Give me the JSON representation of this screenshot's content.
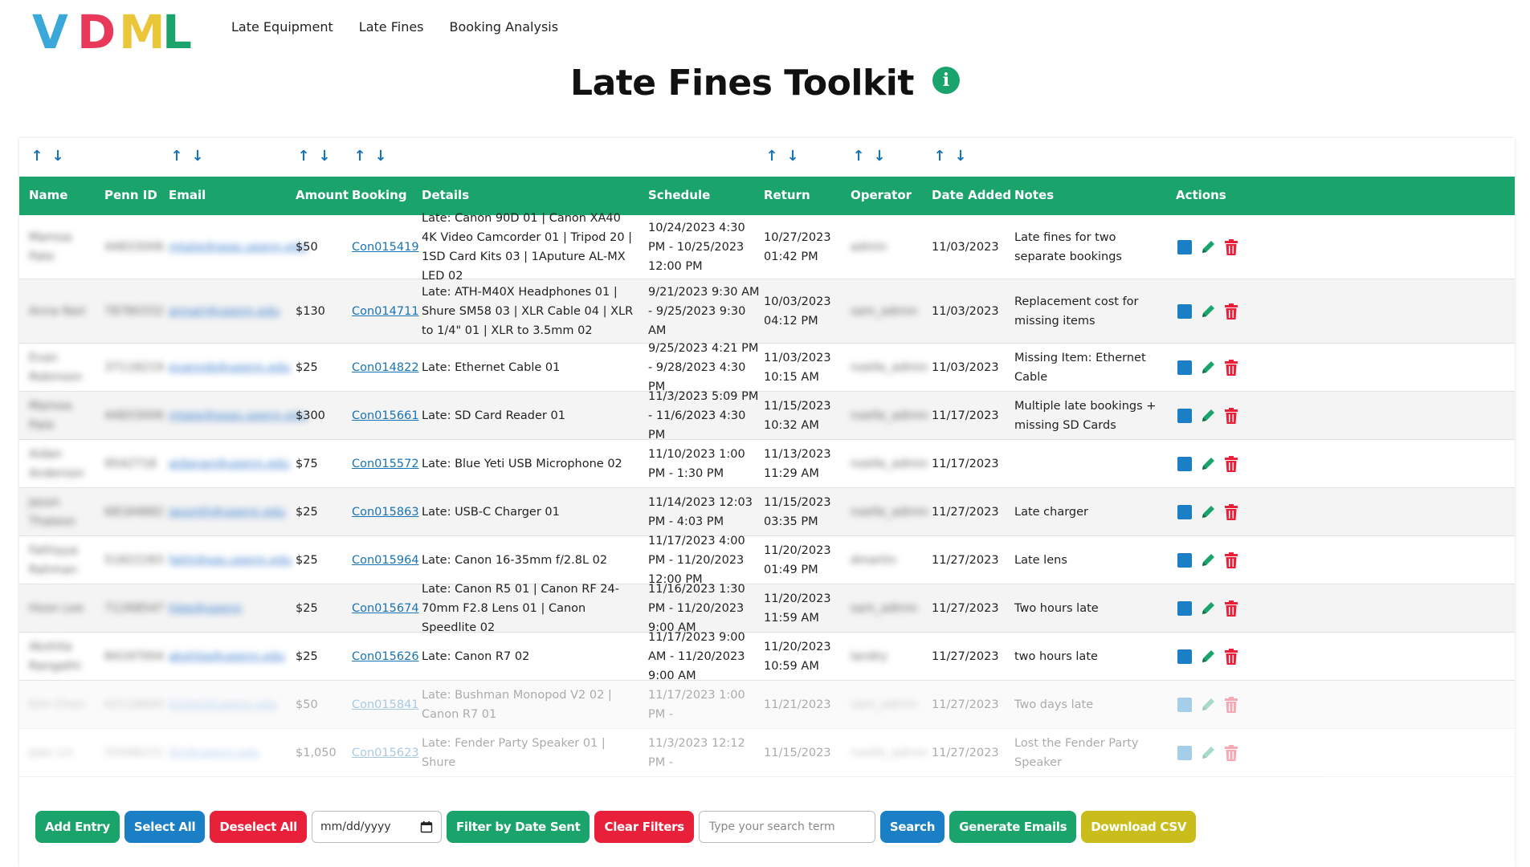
{
  "logo": {
    "text": "VDML",
    "letters": [
      "V",
      "D",
      "M",
      "L"
    ],
    "colors": [
      "#3aa8d8",
      "#e8395a",
      "#e9c63a",
      "#1aa36b"
    ]
  },
  "nav": {
    "items": [
      "Late Equipment",
      "Late Fines",
      "Booking Analysis"
    ]
  },
  "page": {
    "title": "Late Fines Toolkit",
    "info_glyph": "i"
  },
  "colors": {
    "accent": "#1aa36b",
    "link": "#1a73b5",
    "danger": "#e8203a",
    "olive": "#c9bd1c",
    "blue": "#1a7fc4"
  },
  "table": {
    "headers": [
      "Name",
      "Penn ID",
      "Email",
      "Amount",
      "Booking",
      "Details",
      "Schedule",
      "Return",
      "Operator",
      "Date Added",
      "Notes",
      "Actions"
    ],
    "sort_arrows": {
      "up": "↑",
      "down": "↓"
    },
    "rows": [
      {
        "name": "Mamoa Pate",
        "penn_id": "44833006",
        "email": "mtate@seas.upenn.edu",
        "amount": "$50",
        "booking": "Con015419",
        "details": "Late: Canon 90D 01 | Canon XA40 4K Video Camcorder 01 | Tripod 20 | 1SD Card Kits 03 | 1Aputure AL-MX LED 02",
        "schedule": "10/24/2023 4:30 PM - 10/25/2023 12:00 PM",
        "return": "10/27/2023 01:42 PM",
        "operator": "admin",
        "date_added": "11/03/2023",
        "notes": "Late fines for two separate bookings"
      },
      {
        "name": "Anna Nair",
        "penn_id": "78780332",
        "email": "annair@upenn.edu",
        "amount": "$130",
        "booking": "Con014711",
        "details": "Late: ATH-M40X Headphones 01 | Shure SM58 03 | XLR Cable 04 | XLR to 1/4\" 01 | XLR to 3.5mm 02",
        "schedule": "9/21/2023 9:30 AM - 9/25/2023 9:30 AM",
        "return": "10/03/2023 04:12 PM",
        "operator": "sam_admin",
        "date_added": "11/03/2023",
        "notes": "Replacement cost for missing items"
      },
      {
        "name": "Evan Robinson",
        "penn_id": "37118219",
        "email": "evanrob@upenn.edu",
        "amount": "$25",
        "booking": "Con014822",
        "details": "Late: Ethernet Cable 01",
        "schedule": "9/25/2023 4:21 PM - 9/28/2023 4:30 PM",
        "return": "11/03/2023 10:15 AM",
        "operator": "noelle_admin",
        "date_added": "11/03/2023",
        "notes": "Missing Item: Ethernet Cable"
      },
      {
        "name": "Mamoa Pate",
        "penn_id": "44833006",
        "email": "mtate@seas.upenn.edu",
        "amount": "$300",
        "booking": "Con015661",
        "details": "Late: SD Card Reader 01",
        "schedule": "11/3/2023 5:09 PM - 11/6/2023 4:30 PM",
        "return": "11/15/2023 10:32 AM",
        "operator": "noelle_admin",
        "date_added": "11/17/2023",
        "notes": "Multiple late bookings + missing SD Cards"
      },
      {
        "name": "Aidan Anderson",
        "penn_id": "9542718",
        "email": "aidanan@upenn.edu",
        "amount": "$75",
        "booking": "Con015572",
        "details": "Late: Blue Yeti USB Microphone 02",
        "schedule": "11/10/2023 1:00 PM - 1:30 PM",
        "return": "11/13/2023 11:29 AM",
        "operator": "noelle_admin",
        "date_added": "11/17/2023",
        "notes": ""
      },
      {
        "name": "Jason Thaleon",
        "penn_id": "68184882",
        "email": "jasonth@upenn.edu",
        "amount": "$25",
        "booking": "Con015863",
        "details": "Late: USB-C Charger 01",
        "schedule": "11/14/2023 12:03 PM - 4:03 PM",
        "return": "11/15/2023 03:35 PM",
        "operator": "noelle_admin",
        "date_added": "11/27/2023",
        "notes": "Late charger"
      },
      {
        "name": "Fathiyya Rahman",
        "penn_id": "51822283",
        "email": "fathi@sas.upenn.edu",
        "amount": "$25",
        "booking": "Con015964",
        "details": "Late: Canon 16-35mm f/2.8L 02",
        "schedule": "11/17/2023 4:00 PM - 11/20/2023 12:00 PM",
        "return": "11/20/2023 01:49 PM",
        "operator": "dmartin",
        "date_added": "11/27/2023",
        "notes": "Late lens"
      },
      {
        "name": "Hoon Lee",
        "penn_id": "71268547",
        "email": "hlee@upenn",
        "amount": "$25",
        "booking": "Con015674",
        "details": "Late: Canon R5 01 | Canon RF 24-70mm F2.8 Lens 01 | Canon Speedlite 02",
        "schedule": "11/16/2023 1:30 PM - 11/20/2023 9:00 AM",
        "return": "11/20/2023 11:59 AM",
        "operator": "sam_admin",
        "date_added": "11/27/2023",
        "notes": "Two hours late"
      },
      {
        "name": "Akshita Rangathi",
        "penn_id": "84197004",
        "email": "akshita@upenn.edu",
        "amount": "$25",
        "booking": "Con015626",
        "details": "Late: Canon R7 02",
        "schedule": "11/17/2023 9:00 AM - 11/20/2023 9:00 AM",
        "return": "11/20/2023 10:59 AM",
        "operator": "landry",
        "date_added": "11/27/2023",
        "notes": "two hours late"
      },
      {
        "name": "Kim Chen",
        "penn_id": "62118840",
        "email": "kchen@upenn.edu",
        "amount": "$50",
        "booking": "Con015841",
        "details": "Late: Bushman Monopod V2 02 | Canon R7 01",
        "schedule": "11/17/2023 1:00 PM -",
        "return": "11/21/2023",
        "operator": "sam_admin",
        "date_added": "11/27/2023",
        "notes": "Two days late"
      },
      {
        "name": "Jake Lin",
        "penn_id": "55098231",
        "email": "jlin@upenn.edu",
        "amount": "$1,050",
        "booking": "Con015623",
        "details": "Late: Fender Party Speaker 01 | Shure",
        "schedule": "11/3/2023 12:12 PM -",
        "return": "11/15/2023",
        "operator": "noelle_admin",
        "date_added": "11/27/2023",
        "notes": "Lost the Fender Party Speaker"
      }
    ]
  },
  "toolbar": {
    "add_entry": "Add Entry",
    "select_all": "Select All",
    "deselect_all": "Deselect All",
    "date_placeholder": "mm/dd/yyyy",
    "filter_by_date": "Filter by Date Sent",
    "clear_filters": "Clear Filters",
    "search_placeholder": "Type your search term",
    "search": "Search",
    "generate_emails": "Generate Emails",
    "download_csv": "Download CSV"
  }
}
